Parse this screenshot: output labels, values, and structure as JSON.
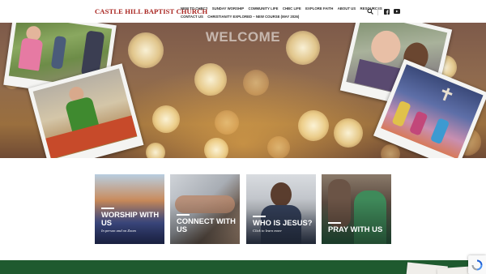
{
  "header": {
    "site_title": "CASTLE HILL BAPTIST CHURCH",
    "nav_row1": [
      "NEW TO CHBC?",
      "SUNDAY WORSHIP",
      "COMMUNITY LIFE",
      "CHBC LIFE",
      "EXPLORE FAITH",
      "ABOUT US",
      "RESOURCES"
    ],
    "nav_row2": [
      "CONTACT US",
      "CHRISTIANITY EXPLORED – NEW COURSE (MAY 2026)"
    ],
    "icons": [
      "search-icon",
      "facebook-icon",
      "youtube-icon"
    ]
  },
  "hero": {
    "heading": "WELCOME"
  },
  "cards": [
    {
      "title": "WORSHIP WITH US",
      "subtitle": "In person and on Zoom"
    },
    {
      "title": "CONNECT WITH US",
      "subtitle": ""
    },
    {
      "title": "WHO IS JESUS?",
      "subtitle": "Click to learn more"
    },
    {
      "title": "PRAY WITH US",
      "subtitle": ""
    }
  ],
  "colors": {
    "brand_red": "#a8231e",
    "footer_green": "#1f5a2f",
    "text_dark": "#2b2b2b"
  }
}
